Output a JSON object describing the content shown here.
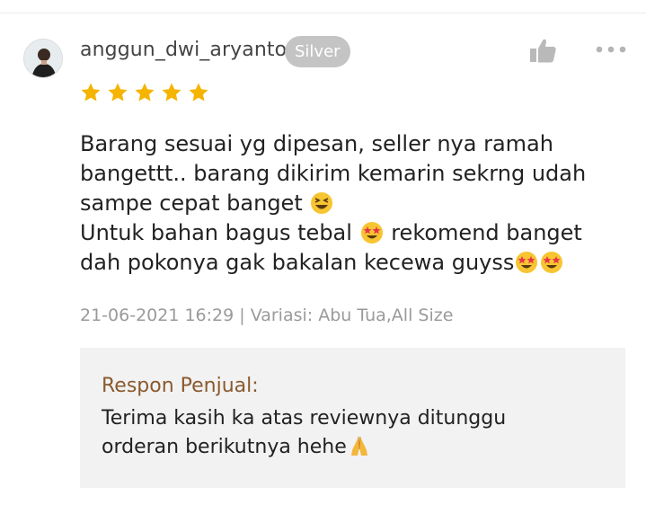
{
  "review": {
    "username": "anggun_dwi_aryanto",
    "badge": "Silver",
    "rating": 5,
    "lines": [
      "Barang sesuai yg dipesan, seller nya ramah",
      "bangettt.. barang dikirim kemarin sekrng udah",
      "sampe cepat banget",
      "Untuk bahan bagus tebal",
      "rekomend banget",
      "dah pokonya gak bakalan kecewa guyss"
    ],
    "meta": "21-06-2021 16:29 | Variasi: Abu Tua,All Size"
  },
  "seller_response": {
    "title": "Respon Penjual:",
    "line1": "Terima kasih ka atas reviewnya ditunggu",
    "line2": "orderan berikutnya hehe"
  },
  "icons": {
    "like": "thumbs-up-icon",
    "more": "more-icon",
    "star": "star-icon",
    "emoji_laugh": "laughing-emoji-icon",
    "emoji_star_eyes": "star-struck-emoji-icon",
    "emoji_pray": "praying-hands-emoji-icon"
  },
  "colors": {
    "star": "#f5b400",
    "badge": "#c4c4c4",
    "seller_title": "#8a5a2e",
    "meta": "#9a9a9a",
    "seller_box": "#f2f2f2"
  }
}
